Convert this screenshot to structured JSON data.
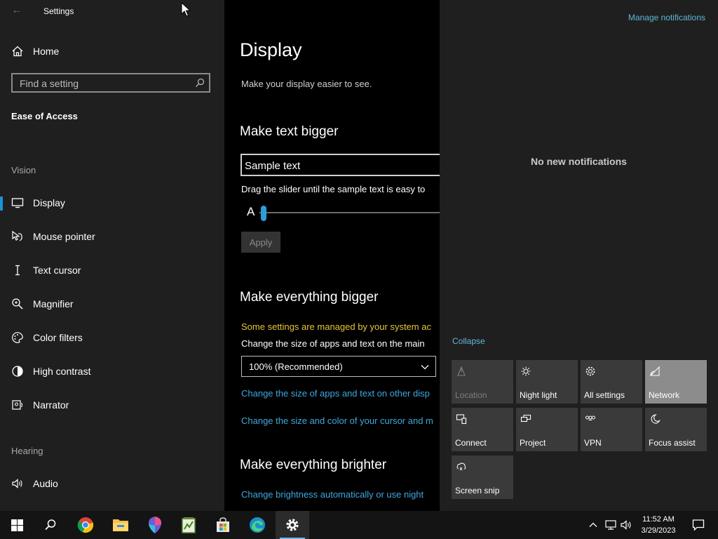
{
  "window": {
    "title": "Settings"
  },
  "sidebar": {
    "home_label": "Home",
    "search_placeholder": "Find a setting",
    "section_title": "Ease of Access",
    "groups": {
      "vision": "Vision",
      "hearing": "Hearing"
    },
    "items": [
      {
        "label": "Display",
        "icon": "monitor-icon",
        "selected": true
      },
      {
        "label": "Mouse pointer",
        "icon": "mouse-pointer-icon"
      },
      {
        "label": "Text cursor",
        "icon": "text-cursor-icon"
      },
      {
        "label": "Magnifier",
        "icon": "magnifier-icon"
      },
      {
        "label": "Color filters",
        "icon": "color-filters-icon"
      },
      {
        "label": "High contrast",
        "icon": "high-contrast-icon"
      },
      {
        "label": "Narrator",
        "icon": "narrator-icon"
      },
      {
        "label": "Audio",
        "icon": "speaker-icon"
      }
    ]
  },
  "main": {
    "title": "Display",
    "description": "Make your display easier to see.",
    "text_bigger": {
      "heading": "Make text bigger",
      "sample": "Sample text",
      "instruction": "Drag the slider until the sample text is easy to",
      "slider_letter": "A",
      "slider_level_percent": 0,
      "apply_label": "Apply"
    },
    "everything_bigger": {
      "heading": "Make everything bigger",
      "warning": "Some settings are managed by your system ac",
      "instruction": "Change the size of apps and text on the main",
      "dropdown_value": "100% (Recommended)",
      "link1": "Change the size of apps and text on other disp",
      "link2": "Change the size and color of your cursor and m"
    },
    "everything_brighter": {
      "heading": "Make everything brighter",
      "link": "Change brightness automatically or use night"
    }
  },
  "action_center": {
    "manage_label": "Manage notifications",
    "empty_label": "No new notifications",
    "collapse_label": "Collapse",
    "tiles": [
      {
        "label": "Location",
        "icon": "location-icon",
        "state": "disabled"
      },
      {
        "label": "Night light",
        "icon": "night-light-icon",
        "state": "off"
      },
      {
        "label": "All settings",
        "icon": "gear-icon",
        "state": "off"
      },
      {
        "label": "Network",
        "icon": "network-icon",
        "state": "on"
      },
      {
        "label": "Connect",
        "icon": "connect-icon",
        "state": "off"
      },
      {
        "label": "Project",
        "icon": "project-icon",
        "state": "off"
      },
      {
        "label": "VPN",
        "icon": "vpn-icon",
        "state": "off"
      },
      {
        "label": "Focus assist",
        "icon": "moon-icon",
        "state": "off"
      },
      {
        "label": "Screen snip",
        "icon": "screen-snip-icon",
        "state": "off"
      }
    ]
  },
  "taskbar": {
    "apps": [
      "start-icon",
      "search-icon",
      "chrome-icon",
      "file-explorer-icon",
      "paint3d-icon",
      "notepad-icon",
      "store-icon",
      "edge-icon",
      "settings-gear-icon"
    ],
    "clock_time": "11:52 AM",
    "clock_date": "3/29/2023"
  },
  "colors": {
    "accent": "#1a93d8",
    "link": "#3fa8df",
    "warning": "#e5c53a",
    "action_link": "#5fb9d8"
  }
}
